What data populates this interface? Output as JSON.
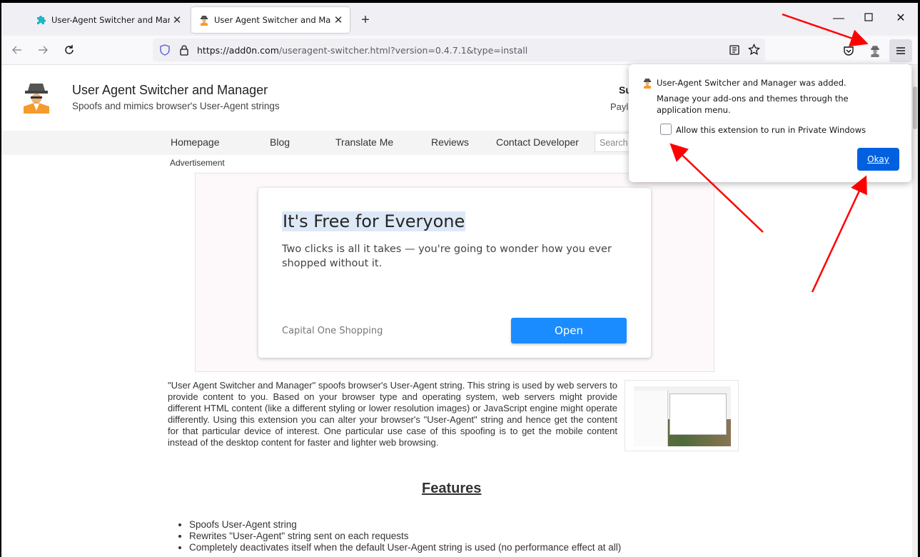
{
  "browser": {
    "tabs": [
      {
        "title": "User-Agent Switcher and Manac",
        "active": false,
        "icon": "puzzle-icon"
      },
      {
        "title": "User Agent Switcher and Manac",
        "active": true,
        "icon": "agent-icon"
      }
    ],
    "new_tab_label": "+",
    "window_controls": {
      "minimize": "—",
      "maximize": "☐",
      "close": "✕"
    },
    "url_host": "https://add0n.com",
    "url_rest": "/useragent-switcher.html?version=0.4.7.1&type=install"
  },
  "site": {
    "title": "User Agent Switcher and Manager",
    "subtitle": "Spoofs and mimics browser's User-Agent strings",
    "support_label": "Su",
    "payl_label": "Payl",
    "menu": [
      "Homepage",
      "Blog",
      "Translate Me",
      "Reviews",
      "Contact Developer"
    ],
    "search_placeholder": "Search"
  },
  "ad": {
    "label": "Advertisement",
    "title": "It's Free for Everyone",
    "text": "Two clicks is all it takes — you're going to wonder how you ever shopped without it.",
    "brand": "Capital One Shopping",
    "button": "Open"
  },
  "description": "\"User Agent Switcher and Manager\" spoofs browser's User-Agent string. This string is used by web servers to provide content to you. Based on your browser type and operating system, web servers might provide different HTML content (like a different styling or lower resolution images) or JavaScript engine might operate differently. Using this extension you can alter your browser's \"User-Agent\" string and hence get the content for that particular device of interest. One particular use case of this spoofing is to get the mobile content instead of the desktop content for faster and lighter web browsing.",
  "features": {
    "heading": "Features",
    "items": [
      "Spoofs User-Agent string",
      "Rewrites \"User-Agent\" string sent on each requests",
      "Completely deactivates itself when the default User-Agent string is used (no performance effect at all)"
    ]
  },
  "popup": {
    "title": "User-Agent Switcher and Manager was added.",
    "body": "Manage your add-ons and themes through the application menu.",
    "checkbox_label": "Allow this extension to run in Private Windows",
    "checkbox_checked": false,
    "okay_button": "Okay"
  },
  "colors": {
    "accent": "#0061e0",
    "ad_button": "#1a8cff",
    "annotation_arrow": "#ff0000"
  }
}
